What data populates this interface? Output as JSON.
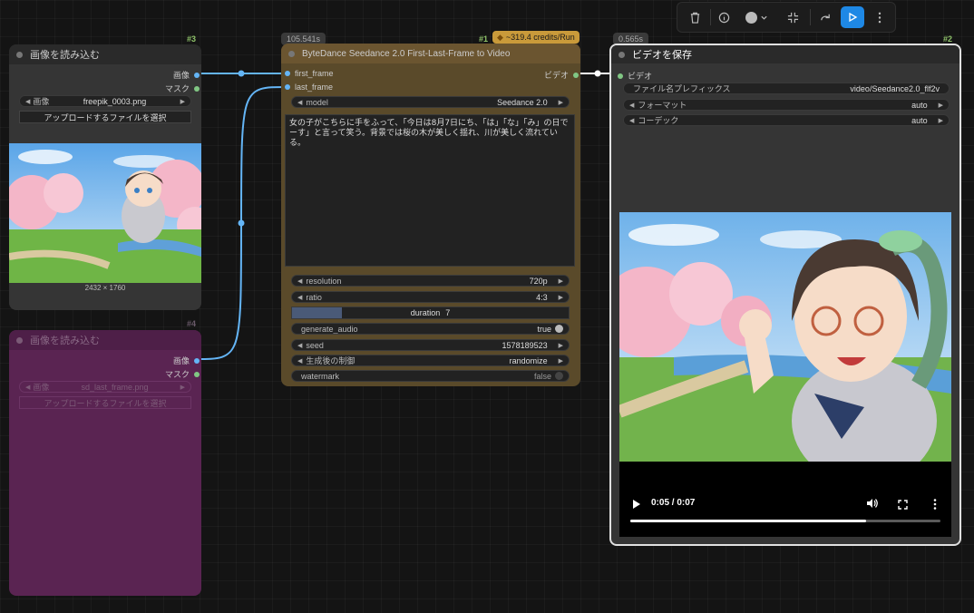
{
  "toolbar": {
    "icons": [
      "trash-icon",
      "info-icon",
      "color-circle-icon",
      "chevron-down-icon",
      "collapse-icon",
      "redo-icon",
      "play-icon",
      "more-vertical-icon"
    ]
  },
  "node3": {
    "id": "#3",
    "title": "画像を読み込む",
    "out_image": "画像",
    "out_mask": "マスク",
    "image_label": "画像",
    "image_value": "freepik_0003.png",
    "upload_label": "アップロードするファイルを選択",
    "dimensions": "2432 × 1760"
  },
  "node4": {
    "id": "#4",
    "title": "画像を読み込む",
    "out_image": "画像",
    "out_mask": "マスク",
    "image_label": "画像",
    "image_value": "sd_last_frame.png",
    "upload_label": "アップロードするファイルを選択"
  },
  "node1": {
    "id": "#1",
    "time": "105.541s",
    "credits": "~319.4 credits/Run",
    "title": "ByteDance Seedance 2.0 First-Last-Frame to Video",
    "in_first": "first_frame",
    "in_last": "last_frame",
    "out_video": "ビデオ",
    "model_label": "model",
    "model_value": "Seedance 2.0",
    "prompt": "女の子がこちらに手をふって、「今日は8月7日にち、「は」「な」「み」の日でーす」と言って笑う。背景では桜の木が美しく揺れ、川が美しく流れている。",
    "resolution_label": "resolution",
    "resolution_value": "720p",
    "ratio_label": "ratio",
    "ratio_value": "4:3",
    "duration_label": "duration",
    "duration_value": "7",
    "duration_fill": 0.18,
    "audio_label": "generate_audio",
    "audio_value": "true",
    "seed_label": "seed",
    "seed_value": "1578189523",
    "control_label": "生成後の制御",
    "control_value": "randomize",
    "watermark_label": "watermark",
    "watermark_value": "false"
  },
  "node2": {
    "id": "#2",
    "time": "0.565s",
    "title": "ビデオを保存",
    "in_video": "ビデオ",
    "prefix_label": "ファイル名プレフィックス",
    "prefix_value": "video/Seedance2.0_flf2v",
    "format_label": "フォーマット",
    "format_value": "auto",
    "codec_label": "コーデック",
    "codec_value": "auto",
    "player_time": "0:05 / 0:07",
    "progress": 0.76
  },
  "colors": {
    "accent": "#1e88e5",
    "seedance_node": "#5a4a2a",
    "seedance_title": "#6b5530",
    "load_node_bypassed": "#5a2452",
    "link_image": "#64b5f6",
    "link_video": "#ffffff",
    "slot_mask": "#81c784"
  }
}
